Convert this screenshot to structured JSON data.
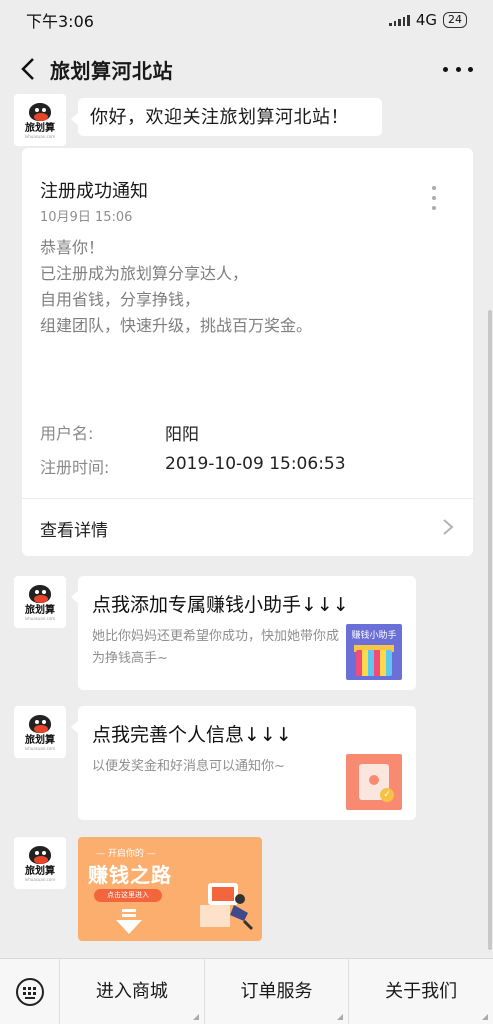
{
  "status_bar": {
    "time": "下午3:06",
    "network": "4G",
    "battery": "24"
  },
  "nav": {
    "title": "旅划算河北站"
  },
  "avatar": {
    "logo_text": "旅划算",
    "logo_sub": "lvhuasuan.com"
  },
  "welcome_message": "你好，欢迎关注旅划算河北站！",
  "notification": {
    "title": "注册成功通知",
    "time": "10月9日 15:06",
    "body_lines": [
      "恭喜你！",
      "已注册成为旅划算分享达人，",
      "自用省钱，分享挣钱，",
      "组建团队，快速升级，挑战百万奖金。"
    ],
    "username_label": "用户名:",
    "username_value": "阳阳",
    "reg_time_label": "注册时间:",
    "reg_time_value": "2019-10-09 15:06:53",
    "detail_label": "查看详情"
  },
  "link_messages": [
    {
      "title": "点我添加专属赚钱小助手↓↓↓",
      "desc": "她比你妈妈还更希望你成功，快加她带你成为挣钱高手~",
      "thumb_label": "赚钱小助手",
      "thumb_icon": "gift-icon"
    },
    {
      "title": "点我完善个人信息↓↓↓",
      "desc": "以便发奖金和好消息可以通知你~",
      "thumb_icon": "profile-card-icon"
    }
  ],
  "banner": {
    "top_text": "— 开启你的 —",
    "main_text": "赚钱之路",
    "button_text": "点击这里进入"
  },
  "bottom_menu": {
    "items": [
      "进入商城",
      "订单服务",
      "关于我们"
    ]
  },
  "colors": {
    "background": "#ededed",
    "banner": "#fcae6e",
    "banner_button": "#f3663d"
  }
}
